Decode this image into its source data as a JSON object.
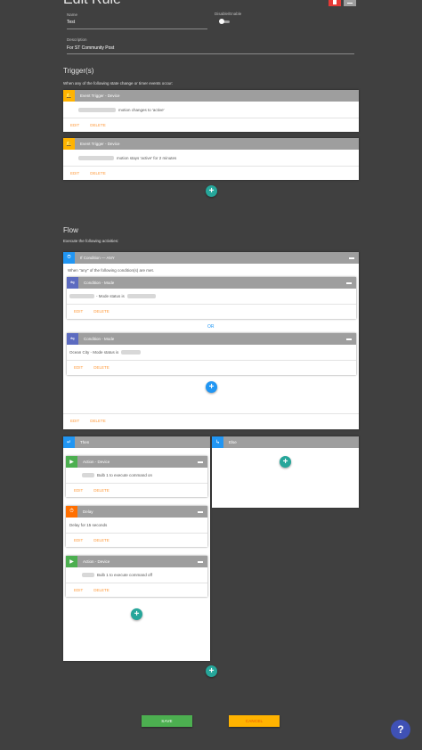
{
  "header": {
    "title": "Edit Rule",
    "delete_color": "#e53935",
    "menu_color": "#9e9e9e"
  },
  "form": {
    "name_label": "Name",
    "name_value": "Test",
    "toggle_label": "Disable/Enable",
    "toggle_on": false,
    "description_label": "Description",
    "description_value": "For ST Community Post"
  },
  "triggers": {
    "heading": "Trigger(s)",
    "subheading": "When any of the following state change or timer events occur:",
    "cards": [
      {
        "title": "Event Trigger - Device",
        "text": "motion changes to 'active'",
        "edit": "EDIT",
        "delete": "DELETE",
        "icon": "bell-icon"
      },
      {
        "title": "Event Trigger - Device",
        "text": "motion stays 'active' for 2 minutes",
        "edit": "EDIT",
        "delete": "DELETE",
        "icon": "bell-icon"
      }
    ]
  },
  "flow": {
    "heading": "Flow",
    "subheading": "Execute the following activities:",
    "if_card": {
      "title": "If Condition — ANY",
      "text": "When \"any\" of the following condition(s) are met.",
      "edit": "EDIT",
      "delete": "DELETE",
      "conditions": [
        {
          "title": "Condition - Mode",
          "prefix": "",
          "text": "- Mode status is",
          "edit": "EDIT",
          "delete": "DELETE"
        },
        {
          "title": "Condition - Mode",
          "prefix": "Ocean City",
          "text": "- Mode status is",
          "edit": "EDIT",
          "delete": "DELETE"
        }
      ],
      "or_label": "OR"
    },
    "then_card": {
      "title": "Then",
      "actions": [
        {
          "title": "Action - Device",
          "text": "Bulb 1 to execute command on",
          "edit": "EDIT",
          "delete": "DELETE",
          "color": "#4caf50"
        },
        {
          "title": "Delay",
          "text": "Delay for 15 seconds",
          "edit": "EDIT",
          "delete": "DELETE",
          "color": "#ff6f00"
        },
        {
          "title": "Action - Device",
          "text": "Bulb 1 to execute command off",
          "edit": "EDIT",
          "delete": "DELETE",
          "color": "#4caf50"
        }
      ]
    },
    "else_card": {
      "title": "Else"
    }
  },
  "footer": {
    "save_label": "SAVE",
    "cancel_label": "CANCEL",
    "help_label": "?"
  },
  "colors": {
    "background": "#404040",
    "teal": "#26a69a",
    "blue": "#2196f3",
    "indigo": "#5c6bc0",
    "amber": "#ffb300",
    "green": "#4caf50",
    "orange": "#ff6f00",
    "save": "#4caf50",
    "cancel": "#ffb300",
    "help": "#3f51b5"
  }
}
